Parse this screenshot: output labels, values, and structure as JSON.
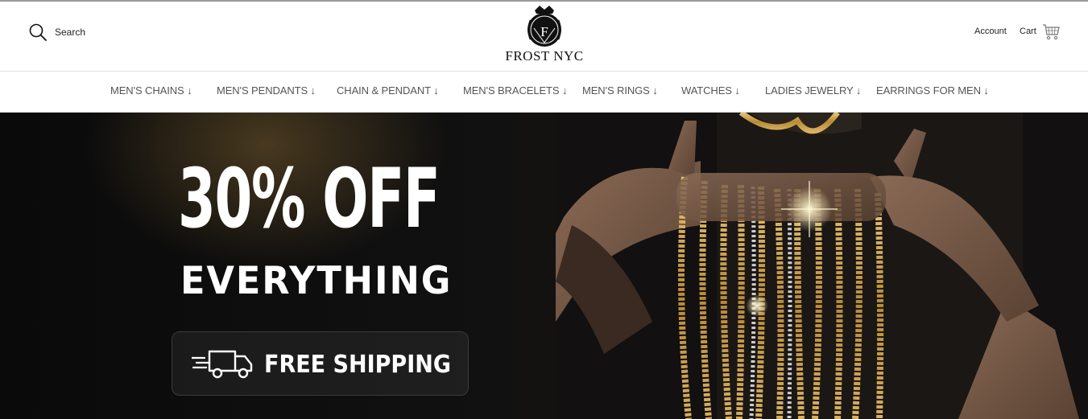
{
  "header": {
    "search_label": "Search",
    "logo_text": "FROST NYC",
    "logo_monogram": "F",
    "account_label": "Account",
    "cart_label": "Cart"
  },
  "nav": {
    "items": [
      "MEN'S CHAINS ↓",
      "MEN'S PENDANTS ↓",
      "CHAIN & PENDANT ↓",
      "MEN'S BRACELETS ↓",
      "MEN'S RINGS ↓",
      "WATCHES ↓",
      "LADIES JEWELRY ↓",
      "EARRINGS FOR MEN ↓"
    ]
  },
  "hero": {
    "headline": "30% OFF",
    "subhead": "EVERYTHING",
    "shipping_label": "FREE SHIPPING",
    "image_icon": "gold-chains-photo"
  },
  "colors": {
    "hero_background": "#0a0a0a",
    "gold": "#c9a14a",
    "nav_text": "#555555"
  }
}
